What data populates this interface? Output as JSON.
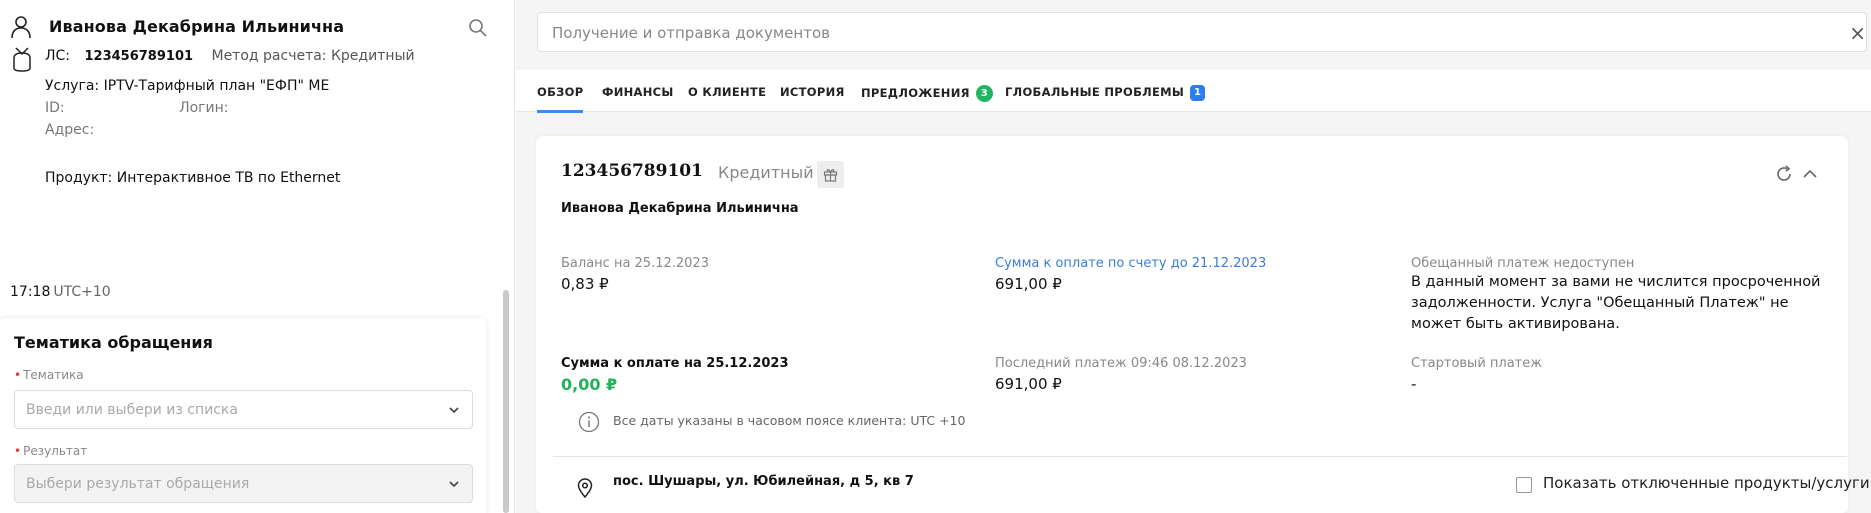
{
  "client": {
    "name": "Иванова Декабрина Ильинична",
    "ls_label": "ЛС:",
    "ls_number": "123456789101",
    "method": "Метод расчета: Кредитный",
    "service": "Услуга: IPTV-Тарифный план \"ЕФП\" МЕ",
    "id_label": "ID:",
    "login_label": "Логин:",
    "address_label": "Адрес:",
    "product": "Продукт: Интерактивное ТВ по Ethernet",
    "time": "17:18",
    "timezone": "UTC+10"
  },
  "topic_form": {
    "title": "Тематика обращения",
    "topic_label": "Тематика",
    "topic_placeholder": "Введи или выбери из списка",
    "result_label": "Результат",
    "result_placeholder": "Выбери результат обращения"
  },
  "search": {
    "placeholder": "Получение и отправка документов",
    "close": "×"
  },
  "tabs": [
    {
      "label": "ОБЗОР",
      "active": true
    },
    {
      "label": "ФИНАНСЫ"
    },
    {
      "label": "О КЛИЕНТЕ"
    },
    {
      "label": "ИСТОРИЯ"
    },
    {
      "label": "ПРЕДЛОЖЕНИЯ",
      "badge": "3"
    },
    {
      "label": "ГЛОБАЛЬНЫЕ ПРОБЛЕМЫ",
      "badge": "1"
    }
  ],
  "account": {
    "number": "123456789101",
    "type": "Кредитный",
    "holder": "Иванова Декабрина Ильинична",
    "balance_label": "Баланс на 25.12.2023",
    "balance_value": "0,83 ₽",
    "due_invoice_label": "Сумма к оплате по счету до 21.12.2023",
    "due_invoice_value": "691,00 ₽",
    "promise_label": "Обещанный платеж недоступен",
    "promise_text": "В данный момент за вами не числится просроченной задолженности. Услуга \"Обещанный Платеж\" не может быть активирована.",
    "due_label": "Сумма к оплате на 25.12.2023",
    "due_value": "0,00 ₽",
    "last_payment_label": "Последний платеж 09:46 08.12.2023",
    "last_payment_value": "691,00 ₽",
    "start_payment_label": "Стартовый платеж",
    "start_payment_value": "-",
    "timezone_note": "Все даты указаны в часовом поясе клиента: UTC +10"
  },
  "address": {
    "text": "пос. Шушары, ул. Юбилейная, д 5, кв 7",
    "show_disabled_label": "Показать отключенные продукты/услуги"
  },
  "colors": {
    "accent": "#3a8cf0",
    "green": "#22b35a",
    "badge_green": "#23b462",
    "badge_blue": "#2b7df0",
    "required": "#e53935"
  }
}
